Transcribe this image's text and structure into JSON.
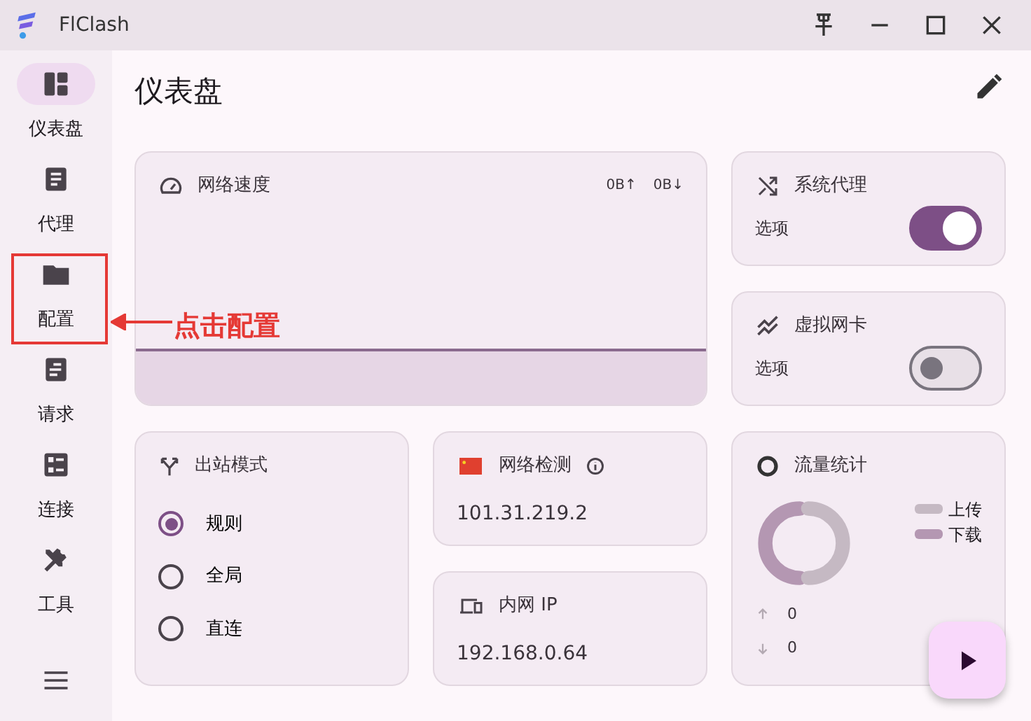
{
  "window": {
    "title": "FlClash"
  },
  "sidebar": {
    "items": [
      {
        "label": "仪表盘",
        "selected": true
      },
      {
        "label": "代理",
        "selected": false
      },
      {
        "label": "配置",
        "selected": false
      },
      {
        "label": "请求",
        "selected": false
      },
      {
        "label": "连接",
        "selected": false
      },
      {
        "label": "工具",
        "selected": false
      }
    ]
  },
  "page_title": "仪表盘",
  "network_speed": {
    "title": "网络速度",
    "upload": "0B↑",
    "download": "0B↓"
  },
  "toggles": [
    {
      "title": "系统代理",
      "subtitle": "选项",
      "on": true
    },
    {
      "title": "虚拟网卡",
      "subtitle": "选项",
      "on": false
    }
  ],
  "outbound_mode": {
    "title": "出站模式",
    "options": [
      {
        "label": "规则",
        "selected": true
      },
      {
        "label": "全局",
        "selected": false
      },
      {
        "label": "直连",
        "selected": false
      }
    ]
  },
  "network_check": {
    "title": "网络检测",
    "value": "101.31.219.2"
  },
  "intranet_ip": {
    "title": "内网 IP",
    "value": "192.168.0.64"
  },
  "traffic": {
    "title": "流量统计",
    "legend": [
      {
        "label": "上传",
        "color": "#c5b9c3"
      },
      {
        "label": "下载",
        "color": "#b497b2"
      }
    ],
    "upload": "0",
    "download": "0"
  },
  "annotation": {
    "text": "点击配置"
  }
}
